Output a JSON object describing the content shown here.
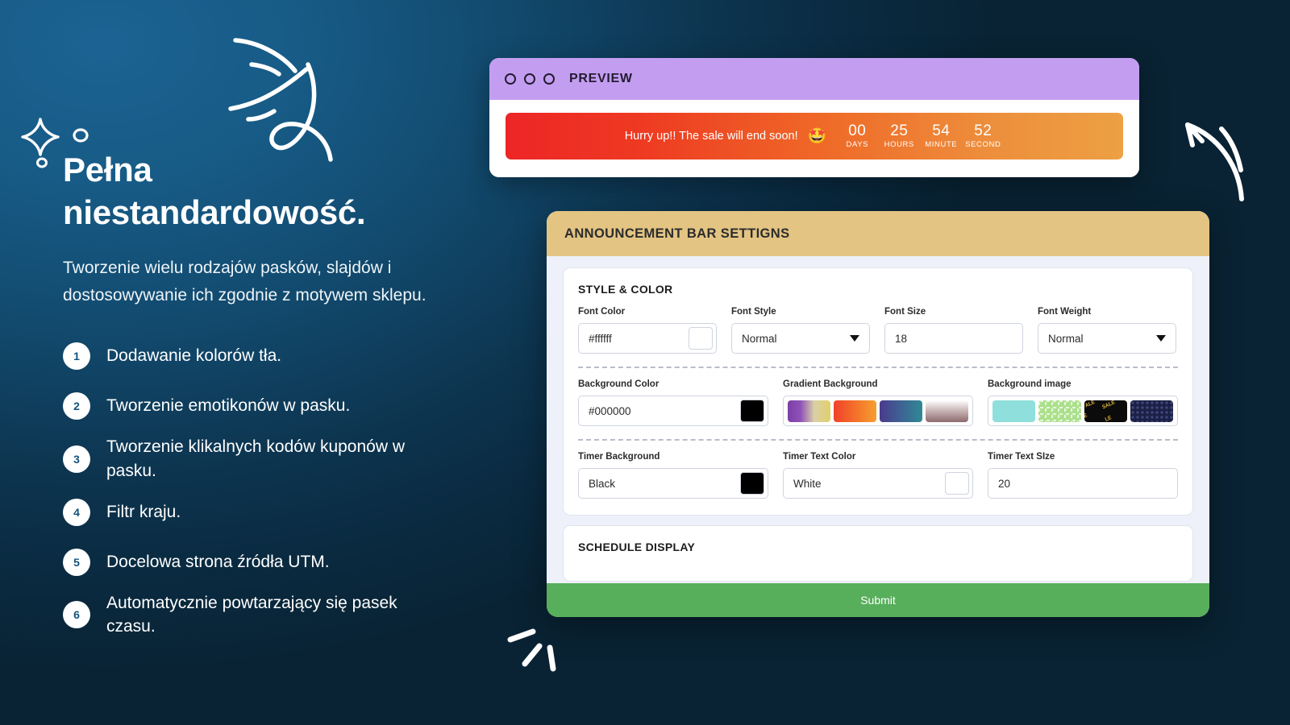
{
  "background": {
    "gradient_from": "#1c6393",
    "gradient_to": "#0a2335"
  },
  "left": {
    "headline_line1": "Pełna",
    "headline_line2": "niestandardowość.",
    "subline": "Tworzenie wielu rodzajów pasków, slajdów i dostosowywanie ich zgodnie z motywem sklepu.",
    "features": [
      {
        "num": "1",
        "text": "Dodawanie kolorów tła."
      },
      {
        "num": "2",
        "text": "Tworzenie emotikonów w pasku."
      },
      {
        "num": "3",
        "text": "Tworzenie klikalnych kodów kuponów w pasku."
      },
      {
        "num": "4",
        "text": "Filtr kraju."
      },
      {
        "num": "5",
        "text": "Docelowa strona źródła UTM."
      },
      {
        "num": "6",
        "text": "Automatycznie powtarzający się pasek czasu."
      }
    ]
  },
  "preview": {
    "title": "PREVIEW",
    "titlebar_color": "#c39ef0",
    "dots": [
      "dot-1",
      "dot-2",
      "dot-3"
    ],
    "bar": {
      "message": "Hurry up!! The sale will end soon!",
      "emoji": "🤩",
      "gradient_from": "#ed2526",
      "gradient_to": "#eda044",
      "timer": [
        {
          "value": "00",
          "label": "DAYS"
        },
        {
          "value": "25",
          "label": "HOURS"
        },
        {
          "value": "54",
          "label": "MINUTE"
        },
        {
          "value": "52",
          "label": "SECOND"
        }
      ]
    }
  },
  "settings": {
    "header_title": "ANNOUNCEMENT BAR SETTIGNS",
    "header_color": "#e3c483",
    "style_color": {
      "section_title": "STYLE & COLOR",
      "font_color": {
        "label": "Font Color",
        "value": "#ffffff",
        "chip": "#ffffff"
      },
      "font_style": {
        "label": "Font Style",
        "value": "Normal"
      },
      "font_size": {
        "label": "Font Size",
        "value": "18"
      },
      "font_weight": {
        "label": "Font Weight",
        "value": "Normal"
      },
      "background_color": {
        "label": "Background Color",
        "value": "#000000",
        "chip": "#000000"
      },
      "gradient_background": {
        "label": "Gradient Background",
        "swatches": [
          "linear-gradient(90deg,#7b3fa8 0%,#8f52b8 30%,#d9d0a8 62%,#e2d06a 100%)",
          "linear-gradient(90deg,#f0412a 0%,#f4742a 55%,#f6a02e 100%)",
          "linear-gradient(90deg,#4a3a8c 0%,#3f5f94 45%,#2f8a93 100%)",
          "linear-gradient(180deg,#ffffff 0%,#c8b4b4 48%,#8d6a6e 100%)"
        ]
      },
      "background_image": {
        "label": "Background image",
        "swatches": [
          "mint-solid",
          "green-scallop-pattern",
          "black-gold-sale",
          "navy-dark-pattern"
        ]
      },
      "timer_background": {
        "label": "Timer Background",
        "value": "Black",
        "chip": "#000000"
      },
      "timer_text_color": {
        "label": "Timer Text Color",
        "value": "White",
        "chip": "#ffffff"
      },
      "timer_text_size": {
        "label": "Timer Text SIze",
        "value": "20"
      }
    },
    "schedule": {
      "section_title": "SCHEDULE DISPLAY"
    },
    "submit_label": "Submit",
    "submit_color": "#57ae5b"
  }
}
